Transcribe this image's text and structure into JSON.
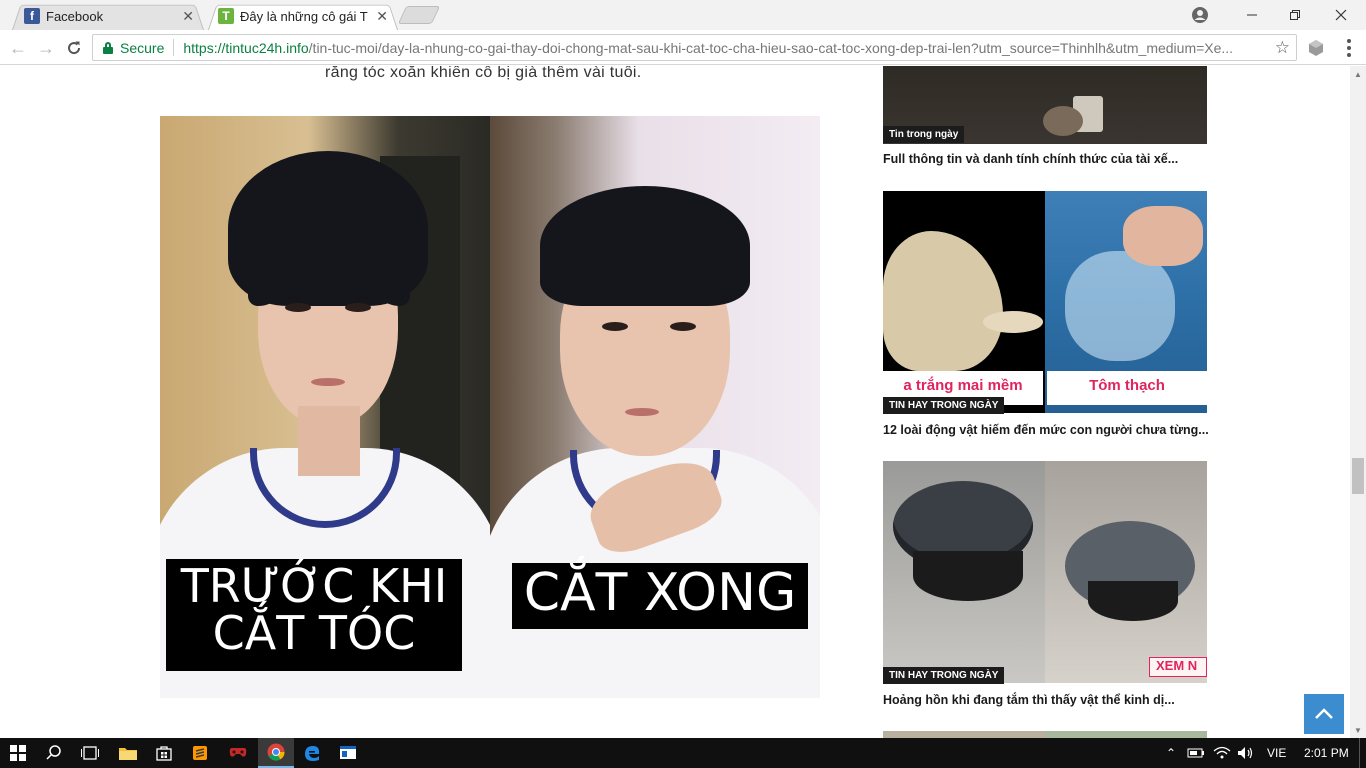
{
  "tabs": [
    {
      "title": "Facebook",
      "favicon": "facebook-icon"
    },
    {
      "title": "Đây là những cô gái THA",
      "favicon": "tintuc24h-icon"
    }
  ],
  "toolbar": {
    "secure_label": "Secure",
    "url_host": "https://tintuc24h.info",
    "url_path": "/tin-tuc-moi/day-la-nhung-co-gai-thay-doi-chong-mat-sau-khi-cat-toc-cha-hieu-sao-cat-toc-xong-dep-trai-len?utm_source=Thinhlh&utm_medium=Xe..."
  },
  "article": {
    "caption": "rằng tóc xoăn khiến cô bị già thêm vài tuổi.",
    "image": {
      "left_label_line1": "TRƯỚC KHI",
      "left_label_line2": "CẮT TÓC",
      "right_label": "CẮT XONG"
    }
  },
  "sidebar": {
    "cards": [
      {
        "badge": "Tin trong ngày",
        "title": "Full thông tin và danh tính chính thức của tài xế..."
      },
      {
        "badge": "TIN HAY TRONG NGÀY",
        "title": "12 loài động vật hiếm đến mức con người chưa từng...",
        "overlay_left": "a trắng mai mềm",
        "overlay_right": "Tôm thạch"
      },
      {
        "badge": "TIN HAY TRONG NGÀY",
        "title": "Hoảng hồn khi đang tắm thì thấy vật thể kinh dị...",
        "overlay_right": "XEM N"
      }
    ]
  },
  "taskbar": {
    "language": "VIE",
    "time": "2:01 PM"
  },
  "colors": {
    "secure_green": "#0b8043",
    "scroll_top_button": "#3c8dcf",
    "badge_bg": "#1c1c1c",
    "taskbar_bg": "#101010"
  }
}
